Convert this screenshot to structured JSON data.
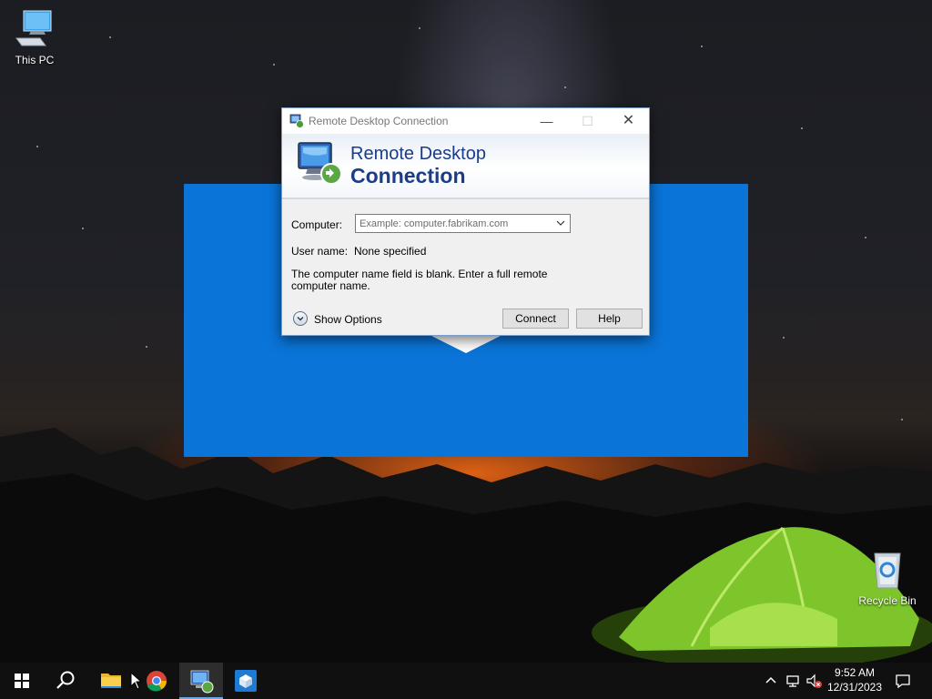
{
  "desktop": {
    "icons": [
      {
        "label": "This PC"
      },
      {
        "label": "Recycle Bin"
      }
    ]
  },
  "dialog": {
    "title": "Remote Desktop Connection",
    "banner_line1": "Remote Desktop",
    "banner_line2": "Connection",
    "computer_label": "Computer:",
    "computer_placeholder": "Example: computer.fabrikam.com",
    "username_label": "User name:",
    "username_value": "None specified",
    "message": "The computer name field is blank. Enter a full remote computer name.",
    "show_options_label": "Show Options",
    "connect_label": "Connect",
    "help_label": "Help"
  },
  "taskbar": {
    "items": [
      "start-icon",
      "search-icon",
      "file-explorer-icon",
      "chrome-icon",
      "remote-desktop-icon",
      "virtualbox-icon"
    ],
    "clock_time": "9:52 AM",
    "clock_date": "12/31/2023",
    "accent": "#6fa8dc"
  },
  "colors": {
    "splash_blue": "#0a74d8",
    "banner_text": "#1a3c8a"
  }
}
